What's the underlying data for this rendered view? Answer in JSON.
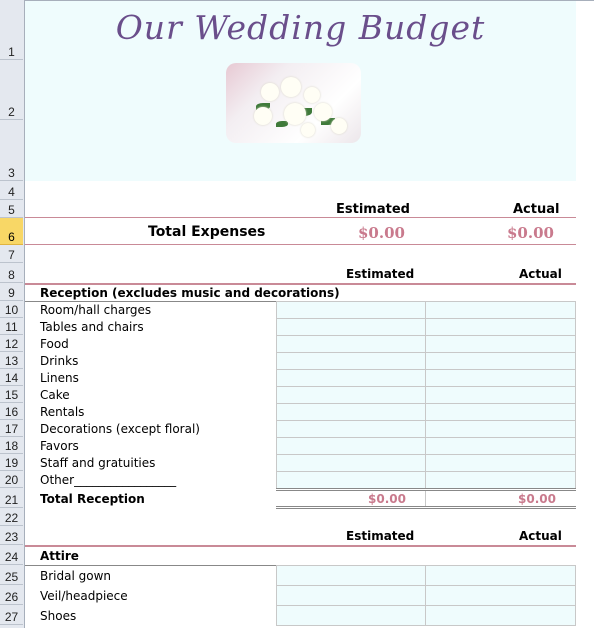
{
  "sheet": {
    "title": "Our Wedding Budget",
    "photo_icon": "wedding-bouquet-photo",
    "row_numbers": [
      "1",
      "2",
      "3",
      "4",
      "5",
      "6",
      "7",
      "8",
      "9",
      "10",
      "11",
      "12",
      "13",
      "14",
      "15",
      "16",
      "17",
      "18",
      "19",
      "20",
      "21",
      "22",
      "23",
      "24",
      "25",
      "26",
      "27"
    ],
    "selected_row": "6",
    "summary": {
      "estimated_header": "Estimated",
      "actual_header": "Actual",
      "label": "Total Expenses",
      "estimated_value": "$0.00",
      "actual_value": "$0.00"
    },
    "reception": {
      "estimated_header": "Estimated",
      "actual_header": "Actual",
      "title": "Reception (excludes music and decorations)",
      "items": [
        {
          "label": "Room/hall charges",
          "estimated": "",
          "actual": ""
        },
        {
          "label": "Tables and chairs",
          "estimated": "",
          "actual": ""
        },
        {
          "label": "Food",
          "estimated": "",
          "actual": ""
        },
        {
          "label": "Drinks",
          "estimated": "",
          "actual": ""
        },
        {
          "label": "Linens",
          "estimated": "",
          "actual": ""
        },
        {
          "label": "Cake",
          "estimated": "",
          "actual": ""
        },
        {
          "label": "Rentals",
          "estimated": "",
          "actual": ""
        },
        {
          "label": "Decorations (except floral)",
          "estimated": "",
          "actual": ""
        },
        {
          "label": "Favors",
          "estimated": "",
          "actual": ""
        },
        {
          "label": "Staff and gratuities",
          "estimated": "",
          "actual": ""
        },
        {
          "label": "Other_________________",
          "estimated": "",
          "actual": ""
        }
      ],
      "total_label": "Total Reception",
      "total_estimated": "$0.00",
      "total_actual": "$0.00"
    },
    "attire": {
      "estimated_header": "Estimated",
      "actual_header": "Actual",
      "title": "Attire",
      "items": [
        {
          "label": "Bridal gown",
          "estimated": "",
          "actual": ""
        },
        {
          "label": "Veil/headpiece",
          "estimated": "",
          "actual": ""
        },
        {
          "label": "Shoes",
          "estimated": "",
          "actual": ""
        }
      ]
    },
    "colors": {
      "banner": "#effcfd",
      "title": "#6a4e8b",
      "accent_rule": "#c98a97",
      "total_value": "#c97a8d",
      "input_cell": "#effcfd",
      "selected_row": "#f8d766"
    }
  }
}
